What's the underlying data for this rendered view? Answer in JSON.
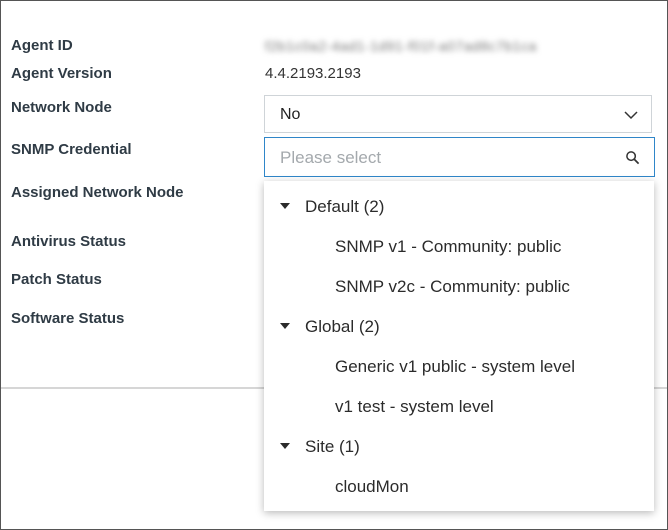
{
  "fields": {
    "agent_id_label": "Agent ID",
    "agent_id_value": "f2b1c0a2-4ad1-1d91-f01f-a07ad8c7b1ca",
    "agent_version_label": "Agent Version",
    "agent_version_value": "4.4.2193.2193",
    "network_node_label": "Network Node",
    "network_node_value": "No",
    "snmp_credential_label": "SNMP Credential",
    "snmp_credential_placeholder": "Please select",
    "assigned_network_node_label": "Assigned Network Node",
    "antivirus_status_label": "Antivirus Status",
    "patch_status_label": "Patch Status",
    "software_status_label": "Software Status"
  },
  "dropdown": {
    "groups": [
      {
        "label": "Default (2)",
        "options": [
          "SNMP v1 - Community: public",
          "SNMP v2c - Community: public"
        ]
      },
      {
        "label": "Global (2)",
        "options": [
          "Generic v1 public - system level",
          "v1 test - system level"
        ]
      },
      {
        "label": "Site (1)",
        "options": [
          "cloudMon"
        ]
      }
    ]
  },
  "icons": {
    "select_chevron": "chevron-down-icon",
    "search": "search-icon",
    "group_toggle": "caret-down-icon"
  },
  "colors": {
    "focus_border": "#2f86c9",
    "label_text": "#2f3b45",
    "placeholder": "#a4a9ad"
  }
}
